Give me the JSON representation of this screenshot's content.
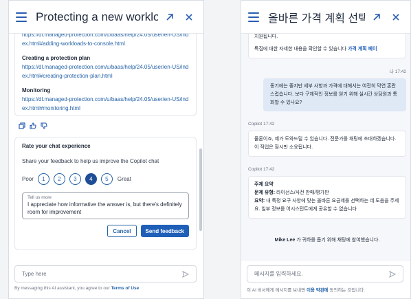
{
  "left_panel": {
    "title": "Protecting a new workload",
    "links": [
      {
        "url": "https://dl.managed-protection.com/u/baas/help/24.05/user/en-US/index.html#adding-workloads-to-console.html"
      },
      {
        "heading": "Creating a protection plan",
        "url": "https://dl.managed-protection.com/u/baas/help/24.05/user/en-US/index.html#creating-protection-plan.html"
      },
      {
        "heading": "Monitoring",
        "url": "https://dl.managed-protection.com/u/baas/help/24.05/user/en-US/index.html#monitoring.html"
      }
    ],
    "rating": {
      "title": "Rate your chat experience",
      "subtitle": "Share your feedback to help us improve the Copilot chat",
      "poor_label": "Poor",
      "great_label": "Great",
      "options": [
        "1",
        "2",
        "3",
        "4",
        "5"
      ],
      "selected": "4",
      "textarea_legend": "Tell us more",
      "textarea_value": "I appreciate how informative the answer is, but there's definitely room for improvement",
      "cancel_label": "Cancel",
      "send_label": "Send feedback"
    },
    "input_placeholder": "Type here",
    "disclaimer_prefix": "By messaging this AI assistant, you agree to our",
    "disclaimer_link": "Terms of Use",
    "colors": {
      "accent": "#1f5fb8",
      "selected": "#1f4e96"
    }
  },
  "right_panel": {
    "title": "올바른 가격 계획 선택",
    "first_msg_line1": "지원됩니다.",
    "first_msg_line2_prefix": "특집에 대한 자세한 내용을 확인할 수 있습니다",
    "first_msg_link": "가격 계획 페이",
    "user_meta": "나  17:42",
    "user_msg": "동기에는 좋지만 세부 사항과 가격에 대해서는 여전히 막연 혼란스럽습니다. 보다 구체적인 정보를 얻기 위해 실시간 상담원과 통화할 수 있나요?",
    "copilot_meta_1": "Copilot  17:42",
    "copilot_msg_1": "물론이죠, 제가 도와드릴 수 있습니다. 전문가를 채팅에 초대하겠습니다. 이 작업은 잠시만 소요됩니다.",
    "copilot_meta_2": "Copilot  17:42",
    "summary_title": "주제 요약",
    "summary_type_label": "문제 유형:",
    "summary_type_value": "라이선스/사전 판매/평가판",
    "summary_label": "요약:",
    "summary_value": "내 특정 요구 사항에 맞는 올바른 요금제를 선택하는 데 도움을 주세요. 일부 정보를 어시스턴트에게 공유할 수 없습니다",
    "system_name": "Mike Lee",
    "system_msg": "가 귀하를 돕기 위해 채팅에 참여했습니다.",
    "input_placeholder": "메시지를 입력하세요.",
    "disclaimer_prefix": "이 AI 비서에게 메시지를 보내면",
    "disclaimer_link": "이용 약관에",
    "disclaimer_suffix": "동의하는 것입니다."
  },
  "icons": [
    "menu-icon",
    "expand-icon",
    "close-icon",
    "copy-icon",
    "thumbs-up-icon",
    "thumbs-down-icon",
    "send-icon"
  ]
}
